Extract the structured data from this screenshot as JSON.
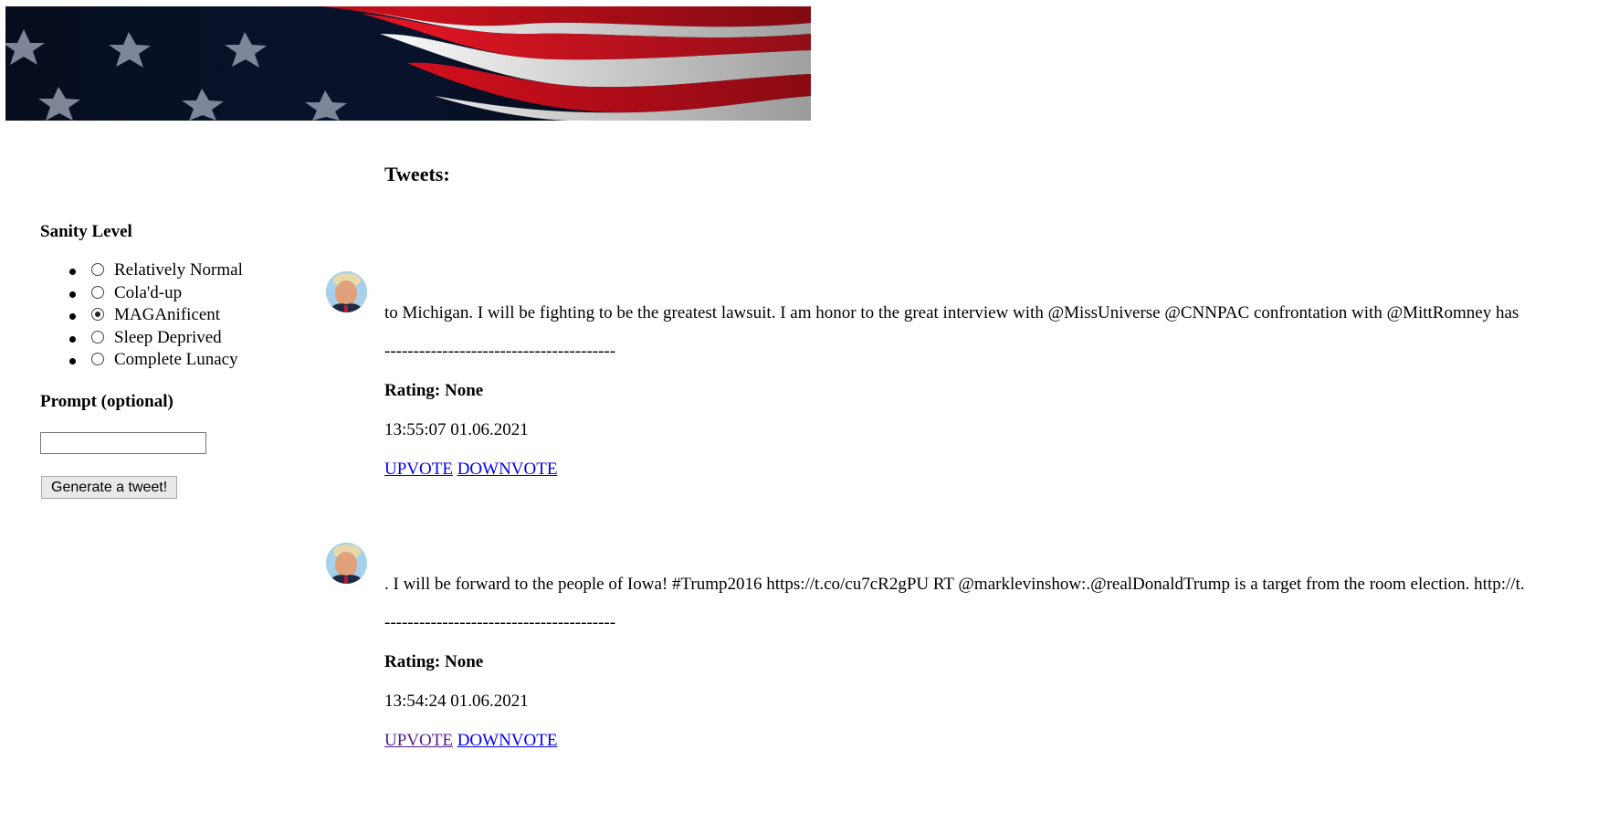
{
  "sidebar": {
    "sanity_heading": "Sanity Level",
    "options": [
      {
        "label": "Relatively Normal",
        "checked": false
      },
      {
        "label": "Cola'd-up",
        "checked": false
      },
      {
        "label": "MAGAnificent",
        "checked": true
      },
      {
        "label": "Sleep Deprived",
        "checked": false
      },
      {
        "label": "Complete Lunacy",
        "checked": false
      }
    ],
    "prompt_heading": "Prompt (optional)",
    "prompt_value": "",
    "generate_label": "Generate a tweet!"
  },
  "main": {
    "tweets_heading": "Tweets:",
    "tweets": [
      {
        "text": "to Michigan. I will be fighting to be the greatest lawsuit. I am honor to the great interview with @MissUniverse @CNNPAC confrontation with @MittRomney has",
        "separator": "----------------------------------------",
        "rating": "Rating: None",
        "timestamp": "13:55:07 01.06.2021",
        "upvote": "UPVOTE",
        "downvote": "DOWNVOTE"
      },
      {
        "text": ". I will be forward to the people of Iowa! #Trump2016 https://t.co/cu7cR2gPU RT @marklevinshow:.@realDonaldTrump is a target from the room election. http://t.",
        "separator": "----------------------------------------",
        "rating": "Rating: None",
        "timestamp": "13:54:24 01.06.2021",
        "upvote": "UPVOTE",
        "downvote": "DOWNVOTE"
      }
    ]
  },
  "colors": {
    "link": "#0000ee",
    "visited_link": "#551a8b",
    "flag_red": "#d90f1c",
    "flag_blue": "#0a1530"
  },
  "icons": {
    "banner": "american-flag-banner",
    "avatar": "profile-avatar-icon"
  }
}
